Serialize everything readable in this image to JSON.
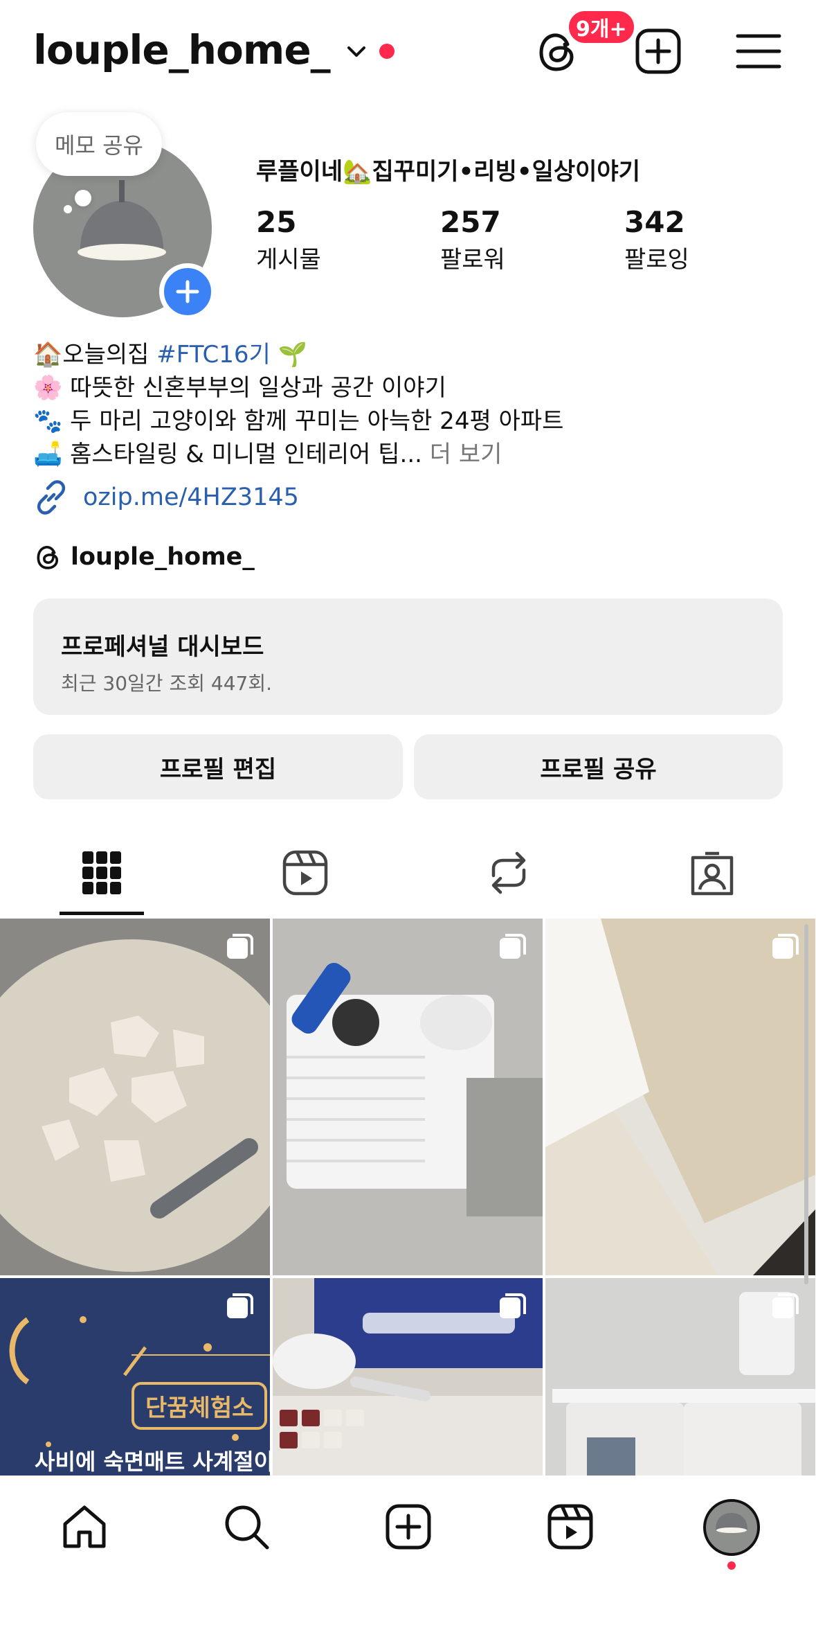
{
  "header": {
    "username": "louple_home_",
    "threads_badge": "9개+"
  },
  "note": {
    "text": "메모 공유"
  },
  "profile": {
    "display_name": "루플이네🏡집꾸미기•리빙•일상이야기",
    "stats": [
      {
        "value": "25",
        "label": "게시물"
      },
      {
        "value": "257",
        "label": "팔로워"
      },
      {
        "value": "342",
        "label": "팔로잉"
      }
    ],
    "bio": {
      "line1_prefix": "🏠오늘의집 ",
      "line1_tag": "#FTC16기",
      "line1_suffix": " 🌱",
      "line2": "🌸 따뜻한 신혼부부의 일상과 공간 이야기",
      "line3": "🐾 두 마리 고양이와 함께 꾸미는 아늑한 24평 아파트",
      "line4": "🛋️ 홈스타일링 & 미니멀 인테리어 팁...",
      "more": " 더 보기"
    },
    "link": "ozip.me/4HZ3145",
    "threads_handle": "louple_home_"
  },
  "dashboard": {
    "title": "프로페셔널 대시보드",
    "subtitle": "최근 30일간 조회 447회."
  },
  "buttons": {
    "edit": "프로필 편집",
    "share": "프로필 공유"
  },
  "tabs": [
    "grid-icon",
    "reels-icon",
    "reposts-icon",
    "tagged-icon"
  ],
  "posts": [
    {
      "name": "post-chicken-soup",
      "bg": "#cfcabe",
      "accent": "#efe9df"
    },
    {
      "name": "post-dehumidifier",
      "bg": "#bdbcb8",
      "accent": "#f2f2f2"
    },
    {
      "name": "post-mattress-topper",
      "bg": "#e6dfd2",
      "accent": "#f7f4ee"
    },
    {
      "name": "post-sleep-experience-box",
      "bg": "#2a3c6b",
      "accent": "#e8b969"
    },
    {
      "name": "post-desk-setup",
      "bg": "#2c3d8e",
      "accent": "#f0ebe4"
    },
    {
      "name": "post-storage-bins",
      "bg": "#d4d4d2",
      "accent": "#f2f2f2"
    }
  ],
  "post_texts": {
    "box_title": "단꿈체험소",
    "box_line": "사비에 숙면매트 사계절이"
  },
  "bottom_nav": [
    "home-icon",
    "search-icon",
    "create-icon",
    "reels-icon",
    "profile-avatar"
  ],
  "colors": {
    "accent_red": "#ff2a4b",
    "link_blue": "#2a5fb0",
    "button_gray": "#efeff0"
  }
}
